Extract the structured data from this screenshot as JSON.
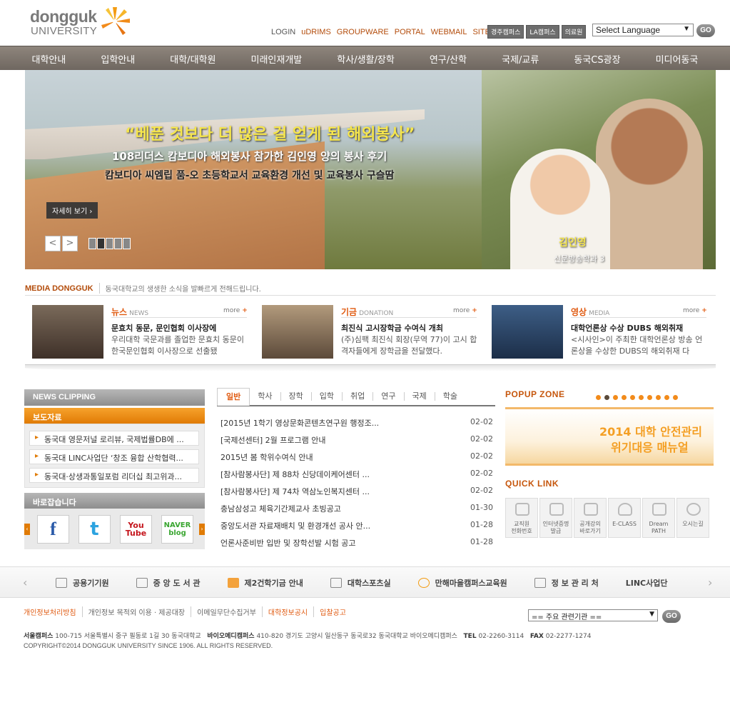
{
  "logo": {
    "line1": "dongguk",
    "line2": "UNIVERSITY"
  },
  "toplinks": [
    "LOGIN",
    "uDRIMS",
    "GROUPWARE",
    "PORTAL",
    "WEBMAIL",
    "SITEMAP"
  ],
  "campus": [
    "경주캠퍼스",
    "LA캠퍼스",
    "의료원"
  ],
  "language": {
    "selected": "Select Language",
    "go": "GO"
  },
  "mainnav": [
    "대학안내",
    "입학안내",
    "대학/대학원",
    "미래인재개발",
    "학사/생활/장학",
    "연구/산학",
    "국제/교류",
    "동국CS광장",
    "미디어동국"
  ],
  "hero": {
    "headline": "“베푼 것보다 더 많은 걸 얻게 된 해외봉사”",
    "sub1": "108리더스 캄보디아 해외봉사 참가한 김인영 양의 봉사 후기",
    "sub2": "캄보디아 씨엠립 품-오 초등학교서 교육환경 개선 및 교육봉사 구슬땀",
    "more": "자세히 보기",
    "prev": "<",
    "next": ">",
    "slide_count": 5,
    "active_slide": 2,
    "name": "김인영",
    "dept": "신문방송학과 3"
  },
  "media": {
    "title": "MEDIA DONGGUK",
    "subtitle": "동국대학교의 생생한 소식을 발빠르게 전해드립니다.",
    "cards": [
      {
        "cat": "뉴스",
        "cat_en": "NEWS",
        "more": "more",
        "headline": "문효치 동문, 문인협회 이사장에",
        "text": "우리대학 국문과를 졸업한 문효치 동문이 한국문인협회 이사장으로 선출됐",
        "thumb_color": "#5c4a3c"
      },
      {
        "cat": "기금",
        "cat_en": "DONATION",
        "more": "more",
        "headline": "최진식 고시장학금 수여식 개최",
        "text": "(주)심팩 최진식 회장(무역 77)이 고시 합격자들에게 장학금을 전달했다.",
        "thumb_color": "#8a6a4a"
      },
      {
        "cat": "영상",
        "cat_en": "MEDIA",
        "more": "more",
        "headline": "대학언론상 수상 DUBS 해외취재",
        "text": "<시사인>이 주최한 대학언론상 방송 언론상을 수상한 DUBS의 해외취재 다",
        "thumb_color": "#2e4a6e"
      }
    ]
  },
  "news_clipping": "NEWS CLIPPING",
  "press": {
    "title": "보도자료",
    "items": [
      "동국대 영문저널 로리뷰, 국제법률DB에 ...",
      "동국대 LINC사업단 ‘창조 융합 산학협력...",
      "동국대·상생과통일포럼 리더십 최고위과..."
    ]
  },
  "baro": "바로잡습니다",
  "sns": [
    "f",
    "t",
    "You Tube",
    "NAVER blog"
  ],
  "tabs": [
    "일반",
    "학사",
    "장학",
    "입학",
    "취업",
    "연구",
    "국제",
    "학술"
  ],
  "notices": [
    {
      "title": "[2015년 1학기 영상문화콘텐츠연구원 행정조...",
      "date": "02-02"
    },
    {
      "title": "[국제선센터] 2월 프로그램 안내",
      "date": "02-02"
    },
    {
      "title": "2015년 봄 학위수여식 안내",
      "date": "02-02"
    },
    {
      "title": "[참사람봉사단] 제 88차 신당데이케어센터 ...",
      "date": "02-02"
    },
    {
      "title": "[참사람봉사단] 제 74차 역삼노인복지센터 ...",
      "date": "02-02"
    },
    {
      "title": "충남삼성고 체육기간제교사 초빙공고",
      "date": "01-30"
    },
    {
      "title": "중앙도서관 자료재배치 및 환경개선 공사 안...",
      "date": "01-28"
    },
    {
      "title": "언론사준비반 입반 및 장학선발 시험 공고",
      "date": "01-28"
    }
  ],
  "popup": {
    "title": "POPUP ZONE",
    "dots": 10,
    "active_dot": 2,
    "line1": "2014 대학 안전관리",
    "line2": "위기대응 매뉴얼"
  },
  "quicklink": {
    "title": "QUICK LINK",
    "items": [
      "교직원\n전화번호",
      "인터넷증명\n발급",
      "공개강의\n바로가기",
      "E-CLASS",
      "Dream\nPATH",
      "오시는길"
    ]
  },
  "footer_links": [
    "공용기기원",
    "중 앙 도 서 관",
    "제2건학기금 안내",
    "대학스포츠실",
    "만해마을캠퍼스교육원",
    "정 보 관 리 처",
    "LINC사업단"
  ],
  "policy": [
    "개인정보처리방침",
    "개인정보 목적외 이용 · 제공대장",
    "이메일무단수집거부",
    "대학정보공시",
    "입찰공고"
  ],
  "org_select": {
    "selected": "== 주요 관련기관 ==",
    "go": "GO"
  },
  "address": {
    "seoul_label": "서울캠퍼스",
    "seoul": "100-715 서울특별시 중구 필동로 1길 30 동국대학교",
    "bio_label": "바이오메디캠퍼스",
    "bio": "410-820 경기도 고양시 일산동구 동국로32 동국대학교 바이오메디캠퍼스",
    "tel_label": "TEL",
    "tel": "02-2260-3114",
    "fax_label": "FAX",
    "fax": "02-2277-1274"
  },
  "copyright": "COPYRIGHT©2014 DONGGUK UNIVERSITY SINCE 1906. ALL RIGHTS RESERVED.",
  "colors": {
    "accent": "#e05a10",
    "nav": "#7a726a",
    "orange": "#f28b1b"
  }
}
